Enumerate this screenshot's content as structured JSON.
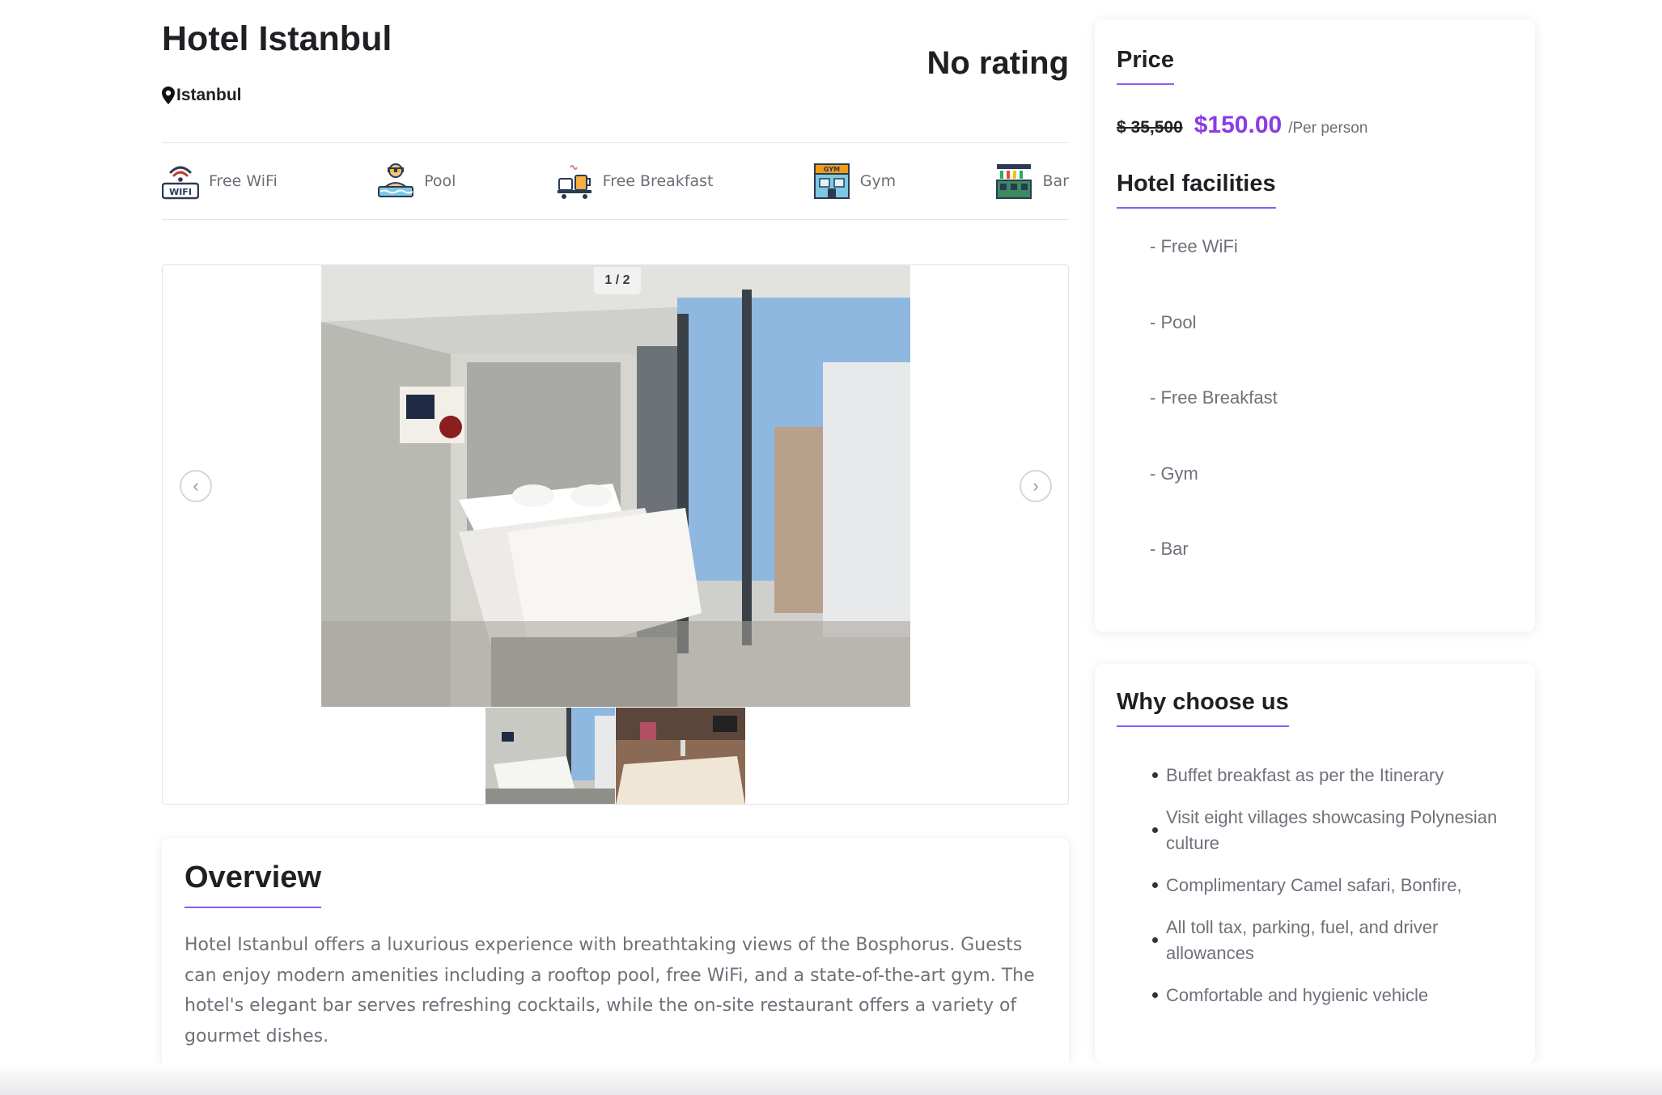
{
  "hotel": {
    "name": "Hotel Istanbul",
    "rating_text": "No rating",
    "location": "Istanbul"
  },
  "facilities": [
    {
      "label": "Free WiFi",
      "icon": "wifi-icon"
    },
    {
      "label": "Pool",
      "icon": "pool-icon"
    },
    {
      "label": "Free Breakfast",
      "icon": "breakfast-icon"
    },
    {
      "label": "Gym",
      "icon": "gym-icon"
    },
    {
      "label": "Bar",
      "icon": "bar-icon"
    }
  ],
  "gallery": {
    "counter": "1 / 2",
    "current": 1,
    "total": 2
  },
  "overview": {
    "heading": "Overview",
    "text": "Hotel Istanbul offers a luxurious experience with breathtaking views of the Bosphorus. Guests can enjoy modern amenities including a rooftop pool, free WiFi, and a state-of-the-art gym. The hotel's elegant bar serves refreshing cocktails, while the on-site restaurant offers a variety of gourmet dishes."
  },
  "price": {
    "heading": "Price",
    "old_price": "$ 35,500",
    "new_price": "$150.00",
    "per": "/Per person"
  },
  "hotel_facilities": {
    "heading": "Hotel facilities",
    "items": [
      "- Free WiFi",
      "- Pool",
      "- Free Breakfast",
      "- Gym",
      "- Bar"
    ]
  },
  "why_choose_us": {
    "heading": "Why choose us",
    "items": [
      "Buffet breakfast as per the Itinerary",
      "Visit eight villages showcasing Polynesian culture",
      "Complimentary Camel safari, Bonfire,",
      "All toll tax, parking, fuel, and driver allowances",
      "Comfortable and hygienic vehicle"
    ]
  },
  "colors": {
    "accent": "#8a3ce6",
    "underline": "#8b5cf6",
    "muted_text": "#6f717a"
  }
}
